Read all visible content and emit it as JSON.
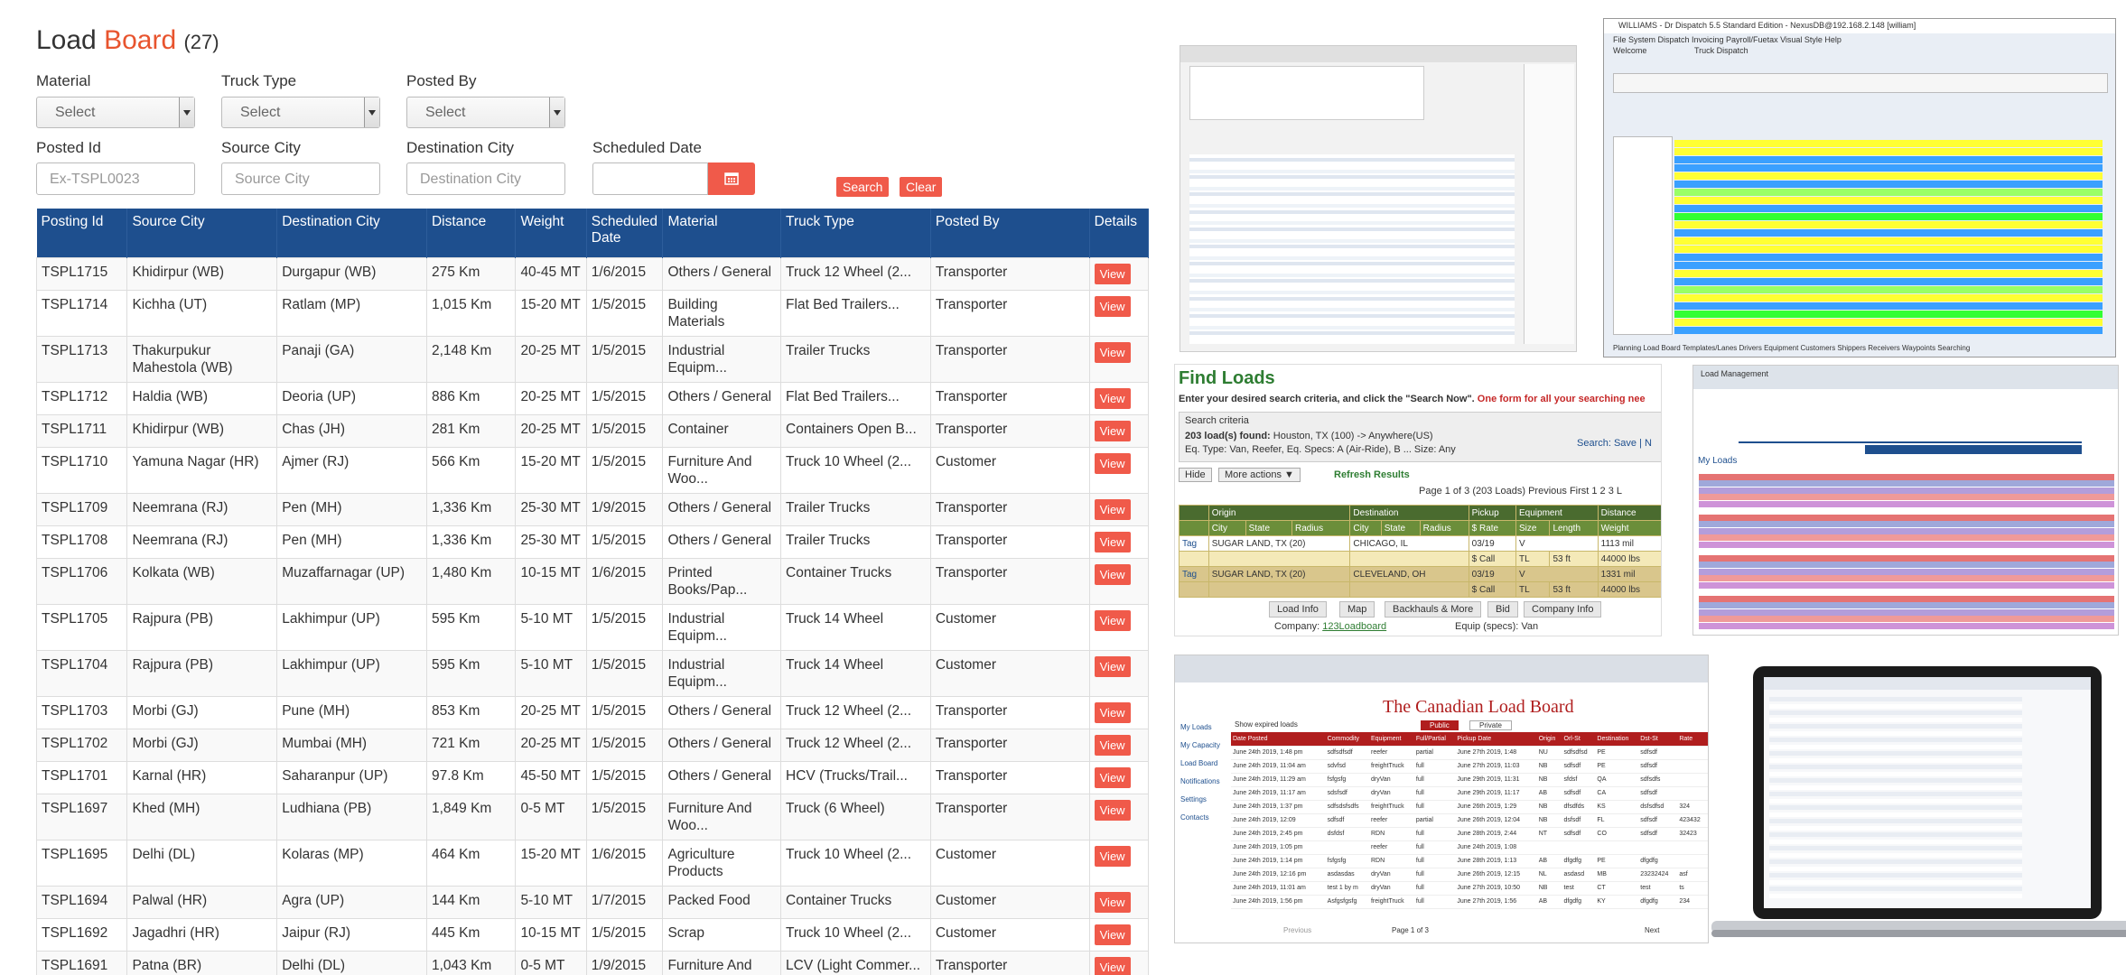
{
  "board": {
    "title_pre": "Load ",
    "title_accent": "Board",
    "title_count": "(27)",
    "filters": {
      "material_label": "Material",
      "truck_type_label": "Truck Type",
      "posted_by_label": "Posted By",
      "select_placeholder": "Select",
      "posted_id_label": "Posted Id",
      "posted_id_placeholder": "Ex-TSPL0023",
      "source_city_label": "Source City",
      "source_city_placeholder": "Source City",
      "destination_city_label": "Destination City",
      "destination_city_placeholder": "Destination City",
      "scheduled_date_label": "Scheduled Date",
      "search_label": "Search",
      "clear_label": "Clear"
    },
    "columns": [
      "Posting Id",
      "Source City",
      "Destination City",
      "Distance",
      "Weight",
      "Scheduled Date",
      "Material",
      "Truck Type",
      "Posted By",
      "Details"
    ],
    "view_label": "View",
    "rows": [
      [
        "TSPL1715",
        "Khidirpur (WB)",
        "Durgapur (WB)",
        "275 Km",
        "40-45 MT",
        "1/6/2015",
        "Others / General",
        "Truck 12 Wheel (2...",
        "Transporter"
      ],
      [
        "TSPL1714",
        "Kichha (UT)",
        "Ratlam (MP)",
        "1,015 Km",
        "15-20 MT",
        "1/5/2015",
        "Building Materials",
        "Flat Bed Trailers...",
        "Transporter"
      ],
      [
        "TSPL1713",
        "Thakurpukur Mahestola (WB)",
        "Panaji (GA)",
        "2,148 Km",
        "20-25 MT",
        "1/5/2015",
        "Industrial Equipm...",
        "Trailer Trucks",
        "Transporter"
      ],
      [
        "TSPL1712",
        "Haldia (WB)",
        "Deoria (UP)",
        "886 Km",
        "20-25 MT",
        "1/5/2015",
        "Others / General",
        "Flat Bed Trailers...",
        "Transporter"
      ],
      [
        "TSPL1711",
        "Khidirpur (WB)",
        "Chas (JH)",
        "281 Km",
        "20-25 MT",
        "1/5/2015",
        "Container",
        "Containers Open B...",
        "Transporter"
      ],
      [
        "TSPL1710",
        "Yamuna Nagar (HR)",
        "Ajmer (RJ)",
        "566 Km",
        "15-20 MT",
        "1/5/2015",
        "Furniture And Woo...",
        "Truck 10 Wheel (2...",
        "Customer"
      ],
      [
        "TSPL1709",
        "Neemrana (RJ)",
        "Pen (MH)",
        "1,336 Km",
        "25-30 MT",
        "1/9/2015",
        "Others / General",
        "Trailer Trucks",
        "Transporter"
      ],
      [
        "TSPL1708",
        "Neemrana (RJ)",
        "Pen (MH)",
        "1,336 Km",
        "25-30 MT",
        "1/5/2015",
        "Others / General",
        "Trailer Trucks",
        "Transporter"
      ],
      [
        "TSPL1706",
        "Kolkata (WB)",
        "Muzaffarnagar (UP)",
        "1,480 Km",
        "10-15 MT",
        "1/6/2015",
        "Printed Books/Pap...",
        "Container Trucks",
        "Transporter"
      ],
      [
        "TSPL1705",
        "Rajpura (PB)",
        "Lakhimpur (UP)",
        "595 Km",
        "5-10 MT",
        "1/5/2015",
        "Industrial Equipm...",
        "Truck 14 Wheel",
        "Customer"
      ],
      [
        "TSPL1704",
        "Rajpura (PB)",
        "Lakhimpur (UP)",
        "595 Km",
        "5-10 MT",
        "1/5/2015",
        "Industrial Equipm...",
        "Truck 14 Wheel",
        "Customer"
      ],
      [
        "TSPL1703",
        "Morbi (GJ)",
        "Pune (MH)",
        "853 Km",
        "20-25 MT",
        "1/5/2015",
        "Others / General",
        "Truck 12 Wheel (2...",
        "Transporter"
      ],
      [
        "TSPL1702",
        "Morbi (GJ)",
        "Mumbai (MH)",
        "721 Km",
        "20-25 MT",
        "1/5/2015",
        "Others / General",
        "Truck 12 Wheel (2...",
        "Transporter"
      ],
      [
        "TSPL1701",
        "Karnal (HR)",
        "Saharanpur (UP)",
        "97.8 Km",
        "45-50 MT",
        "1/5/2015",
        "Others / General",
        "HCV (Trucks/Trail...",
        "Transporter"
      ],
      [
        "TSPL1697",
        "Khed (MH)",
        "Ludhiana (PB)",
        "1,849 Km",
        "0-5 MT",
        "1/5/2015",
        "Furniture And Woo...",
        "Truck (6 Wheel)",
        "Transporter"
      ],
      [
        "TSPL1695",
        "Delhi (DL)",
        "Kolaras (MP)",
        "464 Km",
        "15-20 MT",
        "1/6/2015",
        "Agriculture Products",
        "Truck 10 Wheel (2...",
        "Customer"
      ],
      [
        "TSPL1694",
        "Palwal (HR)",
        "Agra (UP)",
        "144 Km",
        "5-10 MT",
        "1/7/2015",
        "Packed Food",
        "Container Trucks",
        "Customer"
      ],
      [
        "TSPL1692",
        "Jagadhri (HR)",
        "Jaipur (RJ)",
        "445 Km",
        "10-15 MT",
        "1/5/2015",
        "Scrap",
        "Truck 10 Wheel (2...",
        "Customer"
      ],
      [
        "TSPL1691",
        "Patna (BR)",
        "Delhi (DL)",
        "1,043 Km",
        "0-5 MT",
        "1/9/2015",
        "Furniture And Woo...",
        "LCV (Light Commer...",
        "Transporter"
      ]
    ]
  },
  "find_loads": {
    "title": "Find Loads",
    "subtitle": "Enter your desired search criteria, and click the \"Search Now\".",
    "subtitle_red": "One form for all your searching nee",
    "criteria_label": "Search criteria",
    "found_bold": "203 load(s) found:",
    "found_rest": "Houston, TX (100) -> Anywhere(US)",
    "eq_type": "Eq. Type: Van, Reefer, Eq. Specs: A (Air-Ride), B ... Size: Any",
    "search_links": "Search: Save | N",
    "hide_label": "Hide",
    "more_actions": "More actions ▼",
    "refresh": "Refresh Results",
    "page_info": "Page 1 of 3 (203 Loads)  Previous  First  1  2  3  L",
    "head1": [
      "Origin",
      "Destination",
      "Pickup",
      "Equipment",
      "Distance"
    ],
    "head2": [
      "City",
      "State",
      "Radius",
      "City",
      "State",
      "Radius",
      "$ Rate",
      "Size",
      "Length",
      "Weight"
    ],
    "row1": [
      "Tag",
      "SUGAR LAND, TX (20)",
      "CHICAGO, IL",
      "03/19",
      "V",
      "1113 mil"
    ],
    "row1b": [
      "$ Call",
      "TL",
      "53 ft",
      "44000 lbs"
    ],
    "row2": [
      "Tag",
      "SUGAR LAND, TX (20)",
      "CLEVELAND, OH",
      "03/19",
      "V",
      "1331 mil"
    ],
    "row2b": [
      "$ Call",
      "TL",
      "53 ft",
      "44000 lbs"
    ],
    "tabs": [
      "Load Info",
      "Map",
      "Backhauls & More",
      "Bid",
      "Company Info"
    ],
    "company_label": "Company:",
    "company_link": "123Loadboard",
    "equip_specs": "Equip (specs): Van"
  },
  "canadian": {
    "title": "The Canadian Load Board",
    "side_items": [
      "My Loads",
      "My Capacity",
      "Load Board",
      "Notifications",
      "Settings",
      "Contacts"
    ],
    "headers": [
      "Date Posted",
      "Commodity",
      "Equipment",
      "Full/Partial",
      "Pickup Date",
      "Origin",
      "Orl-St",
      "Destination",
      "Dst-St",
      "Rate"
    ],
    "rows": [
      [
        "June 24th 2019, 1:48 pm",
        "sdfsdfsdf",
        "reefer",
        "partial",
        "June 27th 2019, 1:48",
        "NU",
        "sdfsdfsd",
        "PE",
        "sdfsdf",
        ""
      ],
      [
        "June 24th 2019, 11:04 am",
        "sdvfsd",
        "freightTruck",
        "full",
        "June 27th 2019, 11:03",
        "NB",
        "sdfsdf",
        "PE",
        "sdfsdf",
        ""
      ],
      [
        "June 24th 2019, 11:29 am",
        "fsfgsfg",
        "dryVan",
        "full",
        "June 29th 2019, 11:31",
        "NB",
        "sfdsf",
        "QA",
        "sdfsdfs",
        ""
      ],
      [
        "June 24th 2019, 11:17 am",
        "sdsfsdf",
        "dryVan",
        "full",
        "June 29th 2019, 11:17",
        "AB",
        "sdfsdf",
        "CA",
        "sdfsdf",
        ""
      ],
      [
        "June 24th 2019, 1:37 pm",
        "sdfsdsfsdfs",
        "freightTruck",
        "full",
        "June 26th 2019, 1:29",
        "NB",
        "dfsdfds",
        "KS",
        "dsfsdfsd",
        "324"
      ],
      [
        "June 24th 2019, 12:09",
        "sdfsdf",
        "reefer",
        "partial",
        "June 26th 2019, 12:04",
        "NB",
        "dsfsdf",
        "FL",
        "sdfsdf",
        "423432"
      ],
      [
        "June 24th 2019, 2:45 pm",
        "dsfdsf",
        "RDN",
        "full",
        "June 28th 2019, 2:44",
        "NT",
        "sdfsdf",
        "CO",
        "sdfsdf",
        "32423"
      ],
      [
        "June 24th 2019, 1:05 pm",
        "",
        "reefer",
        "full",
        "June 24th 2019, 1:08",
        "",
        "",
        "",
        "",
        ""
      ],
      [
        "June 24th 2019, 1:14 pm",
        "fsfgsfg",
        "RDN",
        "full",
        "June 28th 2019, 1:13",
        "AB",
        "dfgdfg",
        "PE",
        "dfgdfg",
        ""
      ],
      [
        "June 24th 2019, 12:16 pm",
        "asdasdas",
        "dryVan",
        "full",
        "June 26th 2019, 12:15",
        "NL",
        "asdasd",
        "MB",
        "23232424",
        "asf"
      ],
      [
        "June 24th 2019, 11:01 am",
        "test 1 by m",
        "dryVan",
        "full",
        "June 27th 2019, 10:50",
        "NB",
        "test",
        "CT",
        "test",
        "ts"
      ],
      [
        "June 24th 2019, 1:56 pm",
        "Asfgsfgsfg",
        "freightTruck",
        "full",
        "June 27th 2019, 1:56",
        "AB",
        "dfgdfg",
        "KY",
        "dfgdfg",
        "234"
      ]
    ],
    "btn_public": "Public",
    "btn_private": "Private",
    "expired_label": "Show expired loads",
    "pager": "Page  1  of 3",
    "prev": "Previous",
    "next": "Next"
  },
  "drdispatch": {
    "window_title": "WILLIAMS - Dr Dispatch 5.5 Standard Edition - NexusDB@192.168.2.148 [william]",
    "menu": "File  System  Dispatch  Invoicing  Payroll/Fuetax  Visual Style  Help",
    "welcome": "Welcome",
    "truck_dispatch": "Truck Dispatch",
    "bottom_tabs": "Planning  Load Board  Templates/Lanes  Drivers  Equipment  Customers  Shippers  Receivers  Waypoints  Searching"
  },
  "loadmgr": {
    "title": "My Loads",
    "tab": "Load Management"
  }
}
